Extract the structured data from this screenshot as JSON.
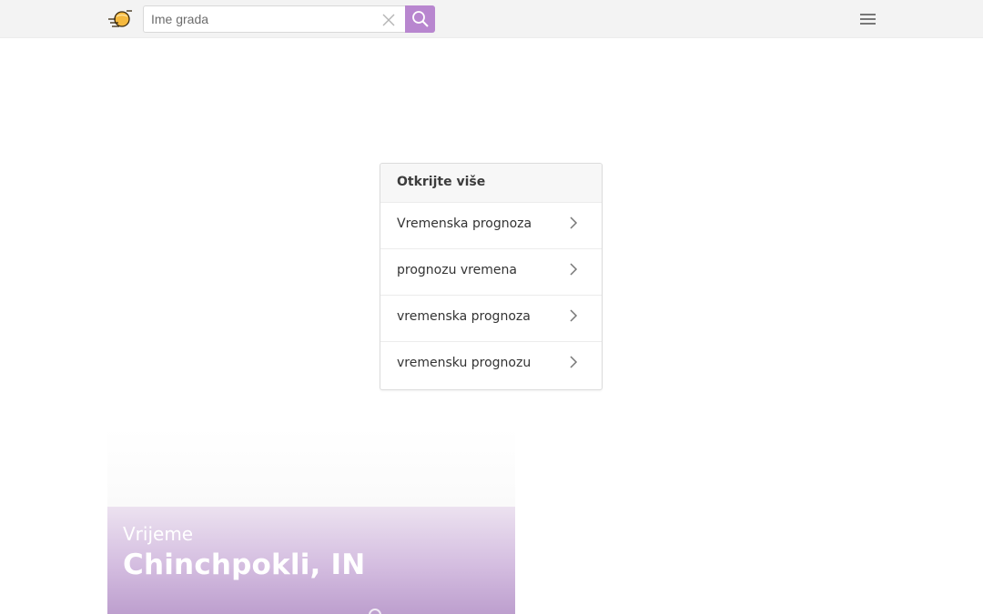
{
  "header": {
    "logo_icon": "sun-logo-icon",
    "search": {
      "placeholder": "Ime grada",
      "value": "",
      "clear_icon": "close-icon",
      "button_icon": "search-icon",
      "button_color": "#b886cf"
    },
    "menu_icon": "hamburger-menu-icon"
  },
  "discover": {
    "title": "Otkrijte više",
    "items": [
      {
        "label": "Vremenska prognoza",
        "icon": "chevron-right-icon"
      },
      {
        "label": "prognozu vremena",
        "icon": "chevron-right-icon"
      },
      {
        "label": "vremenska prognoza",
        "icon": "chevron-right-icon"
      },
      {
        "label": "vremensku prognozu",
        "icon": "chevron-right-icon"
      }
    ]
  },
  "hero": {
    "label": "Vrijeme",
    "city": "Chinchpokli, IN",
    "accent_color": "#bd9fce"
  }
}
